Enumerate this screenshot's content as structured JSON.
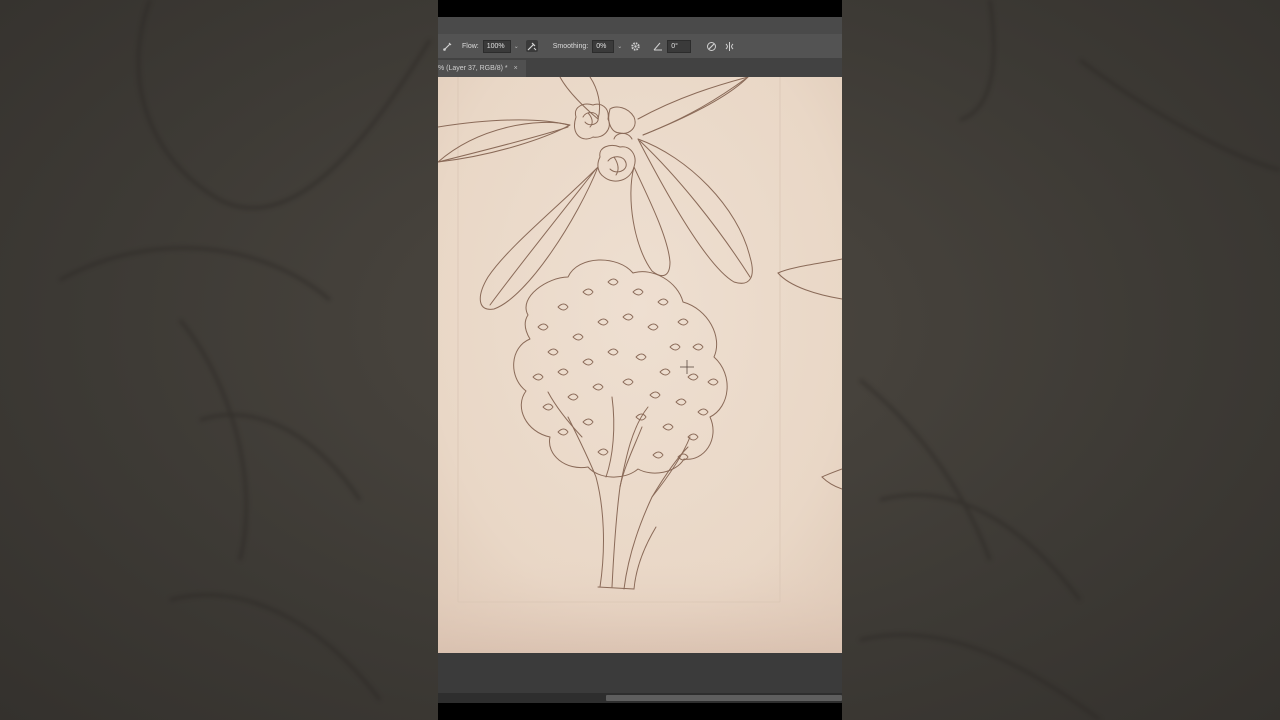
{
  "options_bar": {
    "flow_label": "Flow:",
    "flow_value": "100%",
    "smoothing_label": "Smoothing:",
    "smoothing_value": "0%",
    "angle_value": "0°",
    "icons": [
      "brush-tool-icon",
      "airbrush-icon",
      "gear-icon",
      "angle-icon",
      "pressure-size-icon",
      "symmetry-icon"
    ]
  },
  "document_tab": {
    "title": "% (Layer 37, RGB/8) *",
    "close_glyph": "×"
  },
  "colors": {
    "canvas_paper": "#ead9c9",
    "sketch_line": "#8a6a58",
    "ui_panel": "#535353"
  }
}
